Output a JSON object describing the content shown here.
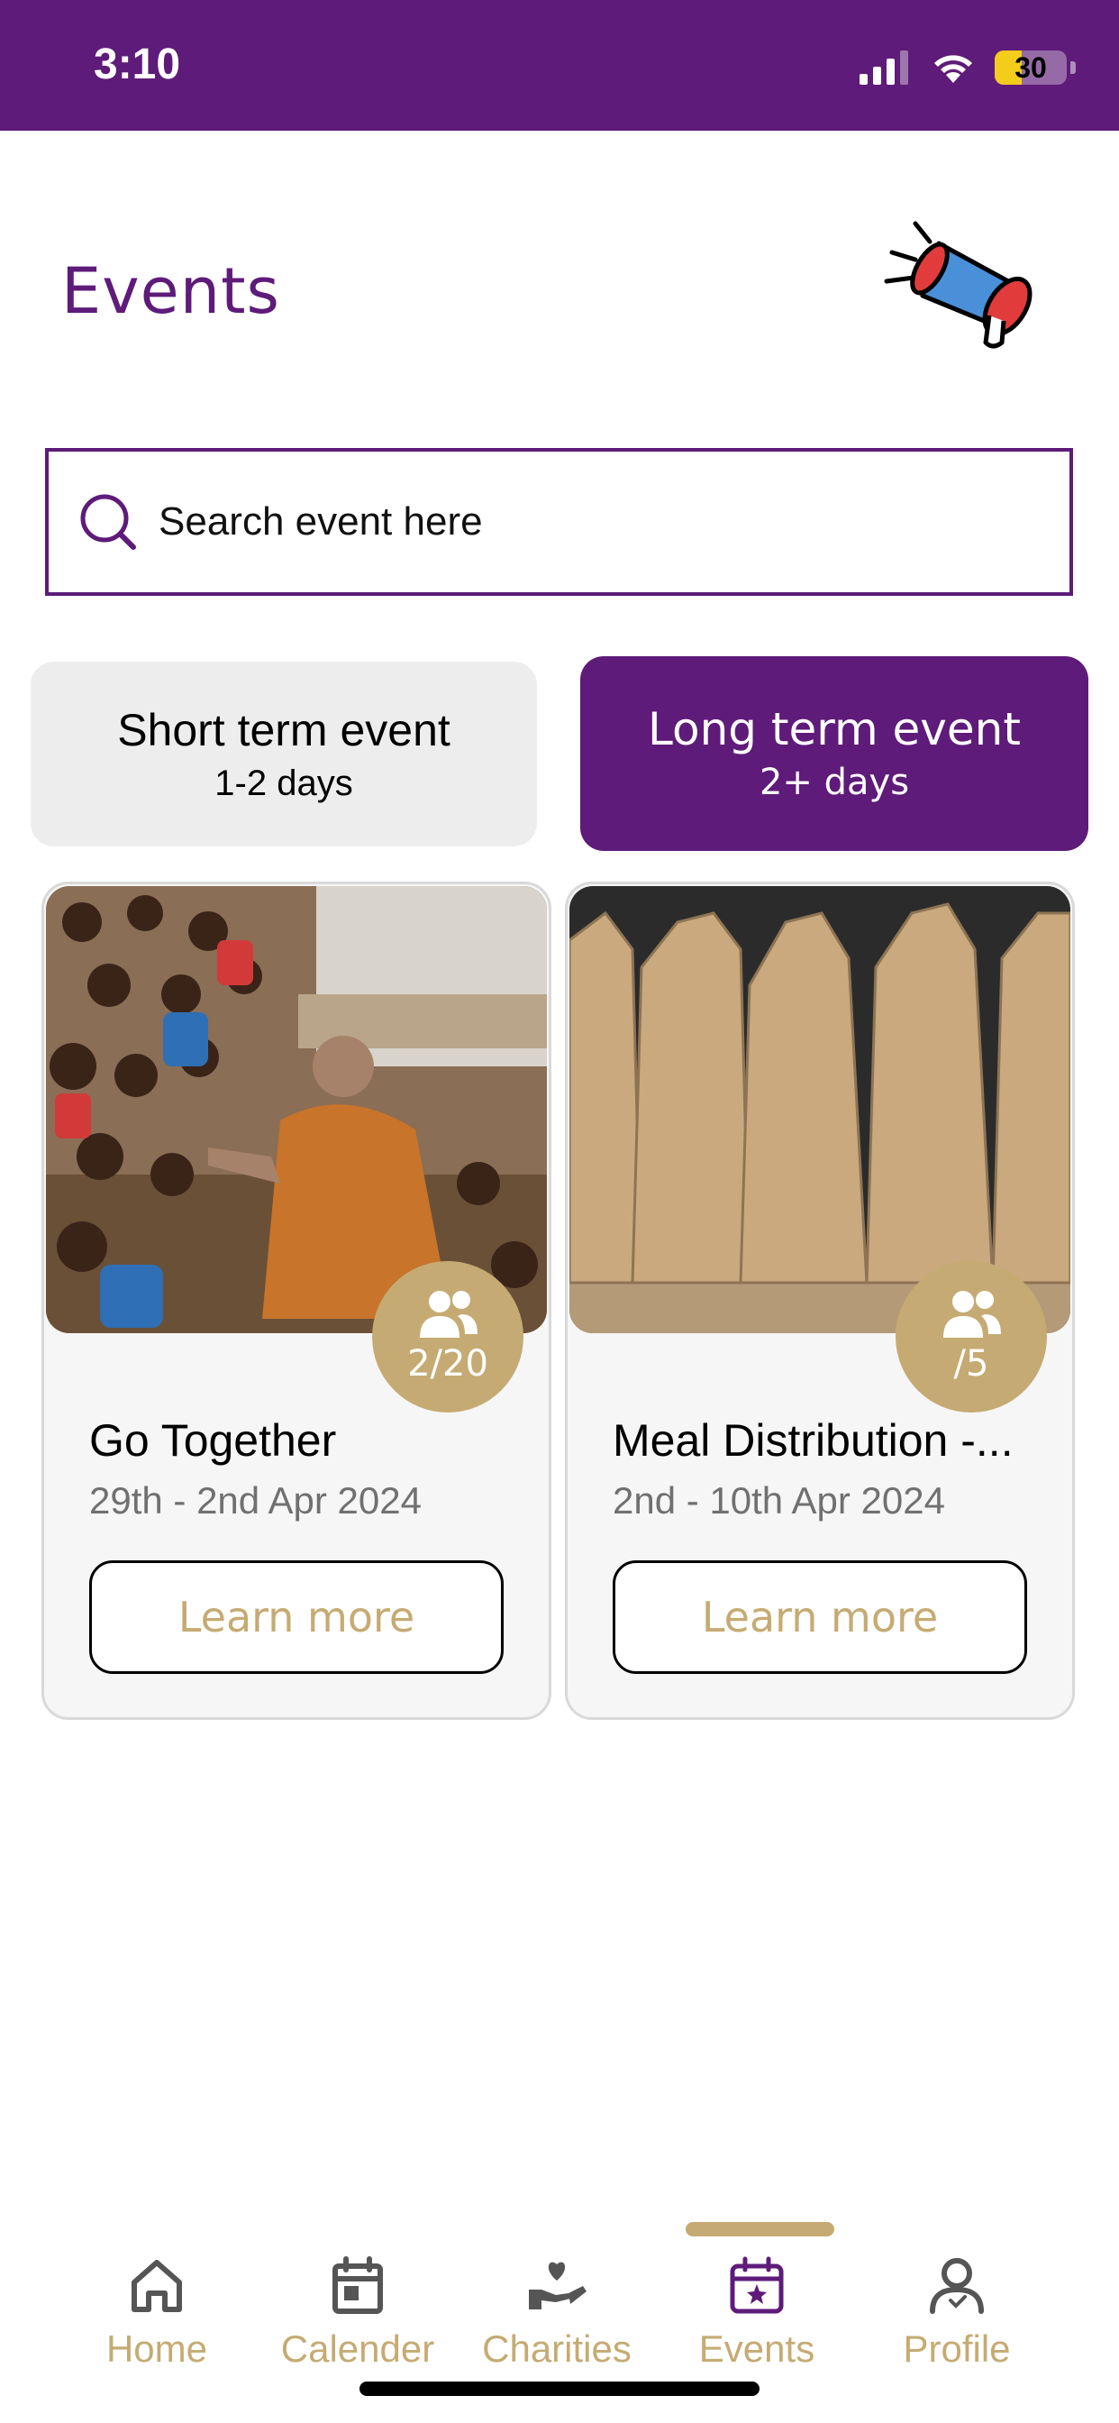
{
  "status_bar": {
    "time": "3:10",
    "battery": "30",
    "signal_icon": "cellular-signal-icon",
    "wifi_icon": "wifi-icon",
    "battery_icon": "battery-icon"
  },
  "header": {
    "title": "Events",
    "illustration": "megaphone-icon"
  },
  "search": {
    "placeholder": "Search event here",
    "value": "",
    "icon": "search-icon"
  },
  "tabs": [
    {
      "title": "Short term event",
      "subtitle": "1-2 days",
      "selected": false
    },
    {
      "title": "Long term event",
      "subtitle": "2+ days",
      "selected": true
    }
  ],
  "events": [
    {
      "title": "Go Together",
      "dates": "29th - 2nd Apr 2024",
      "participants": "2/20",
      "button": "Learn more",
      "participants_icon": "people-icon"
    },
    {
      "title": "Meal Distribution -...",
      "dates": "2nd - 10th Apr 2024",
      "participants": "/5",
      "button": "Learn more",
      "participants_icon": "people-icon"
    }
  ],
  "bottom_nav": [
    {
      "label": "Home",
      "icon": "home-icon",
      "active": false
    },
    {
      "label": "Calender",
      "icon": "calendar-icon",
      "active": false
    },
    {
      "label": "Charities",
      "icon": "charity-hand-heart-icon",
      "active": false
    },
    {
      "label": "Events",
      "icon": "events-calendar-star-icon",
      "active": true
    },
    {
      "label": "Profile",
      "icon": "profile-icon",
      "active": false
    }
  ],
  "colors": {
    "brand_purple": "#5e1b79",
    "accent_gold": "#c5ab73",
    "tab_inactive": "#ededed",
    "card_bg": "#f6f6f6"
  }
}
